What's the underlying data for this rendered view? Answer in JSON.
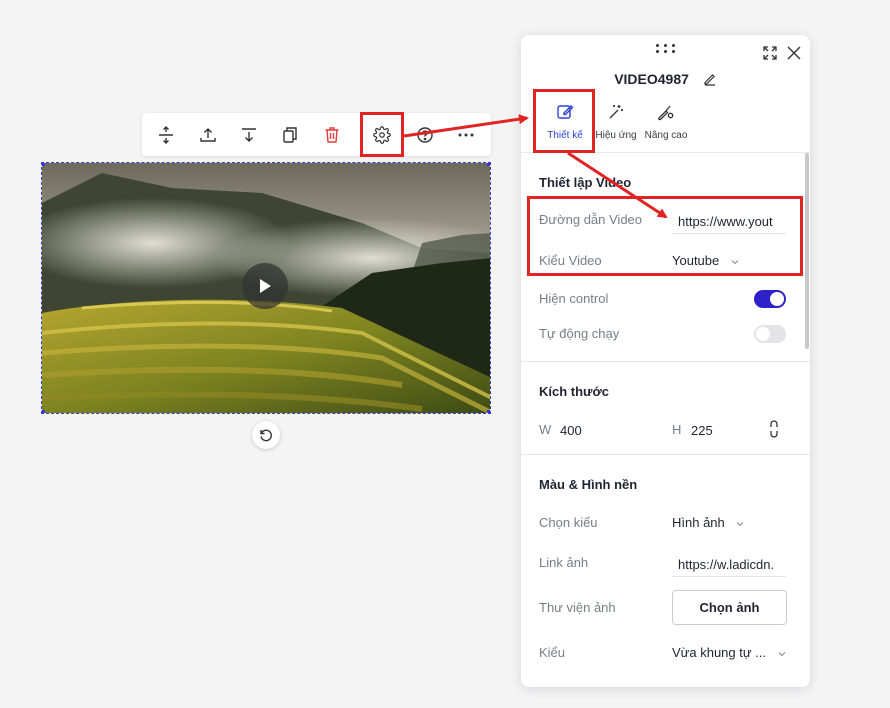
{
  "toolbar": {
    "items": [
      {
        "name": "distribute-vertical-icon"
      },
      {
        "name": "bring-forward-icon"
      },
      {
        "name": "send-backward-icon"
      },
      {
        "name": "duplicate-icon"
      },
      {
        "name": "delete-icon",
        "color": "#e03b3b"
      },
      {
        "name": "settings-icon"
      },
      {
        "name": "help-icon"
      },
      {
        "name": "more-icon"
      }
    ]
  },
  "panel": {
    "title": "VIDEO4987",
    "tabs": [
      {
        "label": "Thiết kế",
        "icon": "edit-icon",
        "active": true
      },
      {
        "label": "Hiệu ứng",
        "icon": "magic-wand-icon",
        "active": false
      },
      {
        "label": "Nâng cao",
        "icon": "advanced-settings-icon",
        "active": false
      }
    ],
    "video_settings": {
      "title": "Thiết lập Video",
      "url_label": "Đường dẫn Video",
      "url_value": "https://www.yout",
      "type_label": "Kiểu Video",
      "type_value": "Youtube",
      "controls_label": "Hiện control",
      "controls_on": true,
      "autoplay_label": "Tự động chạy",
      "autoplay_on": false
    },
    "size": {
      "title": "Kích thước",
      "w_label": "W",
      "w_value": "400",
      "h_label": "H",
      "h_value": "225"
    },
    "background": {
      "title": "Màu & Hình nền",
      "style_label": "Chọn kiểu",
      "style_value": "Hình ảnh",
      "image_link_label": "Link ảnh",
      "image_link_value": "https://w.ladicdn.",
      "library_label": "Thư viện ảnh",
      "choose_button": "Chọn ảnh",
      "fit_label": "Kiểu",
      "fit_value": "Vừa khung tự ..."
    }
  },
  "colors": {
    "accent": "#2d21c9",
    "tab_active": "#2d41d6",
    "annotation": "#e02424",
    "selection": "#3a3ad0"
  }
}
